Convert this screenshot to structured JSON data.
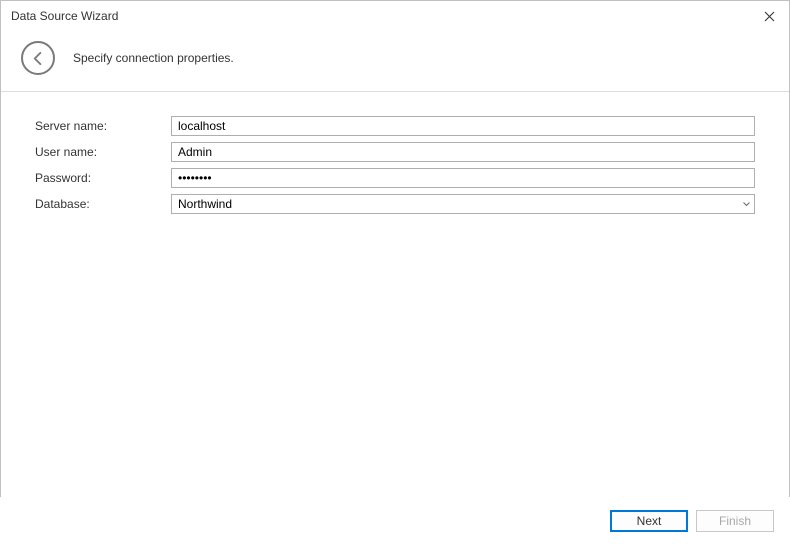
{
  "window": {
    "title": "Data Source Wizard"
  },
  "header": {
    "instruction": "Specify connection properties."
  },
  "form": {
    "server_name": {
      "label": "Server name:",
      "value": "localhost"
    },
    "user_name": {
      "label": "User name:",
      "value": "Admin"
    },
    "password": {
      "label": "Password:",
      "value": "••••••••"
    },
    "database": {
      "label": "Database:",
      "value": "Northwind"
    }
  },
  "footer": {
    "next_label": "Next",
    "finish_label": "Finish"
  }
}
